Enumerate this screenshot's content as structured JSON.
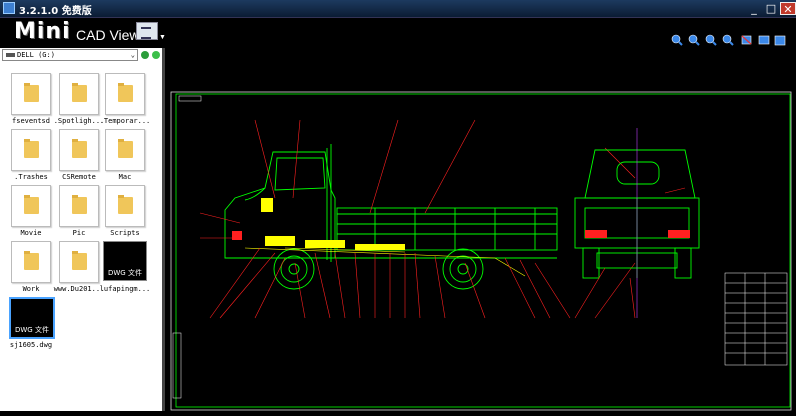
{
  "window": {
    "title": "3.2.1.0 免费版",
    "controls": {
      "minimize": "_",
      "maximize": "□",
      "close": "✕"
    }
  },
  "toolbar": {
    "logo_main": "Mini",
    "logo_sub": "CAD Viewer",
    "tools": [
      "zoom-in-icon",
      "zoom-out-icon",
      "zoom-window-icon",
      "zoom-fit-icon",
      "measure-icon",
      "print-icon",
      "save-icon"
    ]
  },
  "sidebar": {
    "drive": "DELL (G:)",
    "items": [
      {
        "name": "fseventsd",
        "type": "folder"
      },
      {
        "name": ".Spotligh...",
        "type": "folder"
      },
      {
        "name": ".Temporar...",
        "type": "folder"
      },
      {
        "name": ".Trashes",
        "type": "folder"
      },
      {
        "name": "CSRemote",
        "type": "folder"
      },
      {
        "name": "Mac",
        "type": "folder"
      },
      {
        "name": "Movie",
        "type": "folder"
      },
      {
        "name": "Pic",
        "type": "folder"
      },
      {
        "name": "Scripts",
        "type": "folder"
      },
      {
        "name": "Work",
        "type": "folder"
      },
      {
        "name": "www.Du201...",
        "type": "folder"
      },
      {
        "name": "lufapingm...",
        "type": "dwg",
        "badge": "DWG 文件"
      },
      {
        "name": "sj1605.dwg",
        "type": "dwg",
        "badge": "DWG 文件",
        "selected": true
      }
    ]
  },
  "colors": {
    "accent": "#4aa3ff",
    "drawing_green": "#00ff00",
    "drawing_red": "#ff2020",
    "drawing_yellow": "#ffff00"
  }
}
